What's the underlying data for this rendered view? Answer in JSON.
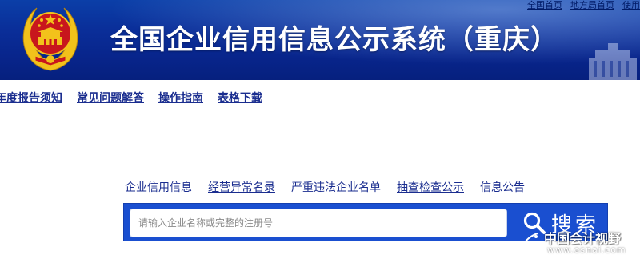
{
  "header": {
    "title": "全国企业信用信息公示系统（重庆）",
    "top_links": [
      "全国首页",
      "地方局首页",
      "使用"
    ]
  },
  "subnav": {
    "items": [
      "年度报告须知",
      "常见问题解答",
      "操作指南",
      "表格下载"
    ]
  },
  "search": {
    "tabs": [
      "企业信用信息",
      "经营异常名录",
      "严重违法企业名单",
      "抽查检查公示",
      "信息公告"
    ],
    "placeholder": "请输入企业名称或完整的注册号",
    "button_label": "搜索"
  },
  "watermark": {
    "text": "中国会计视野",
    "url": "www.esnai.com"
  },
  "colors": {
    "banner": "#0a2f9a",
    "link": "#1a2d8f",
    "search_bar": "#1a4fd0",
    "emblem_red": "#c8161d",
    "emblem_gold": "#f2c21b"
  },
  "icons": [
    "national-emblem-icon",
    "search-icon",
    "watermark-logo-icon"
  ]
}
